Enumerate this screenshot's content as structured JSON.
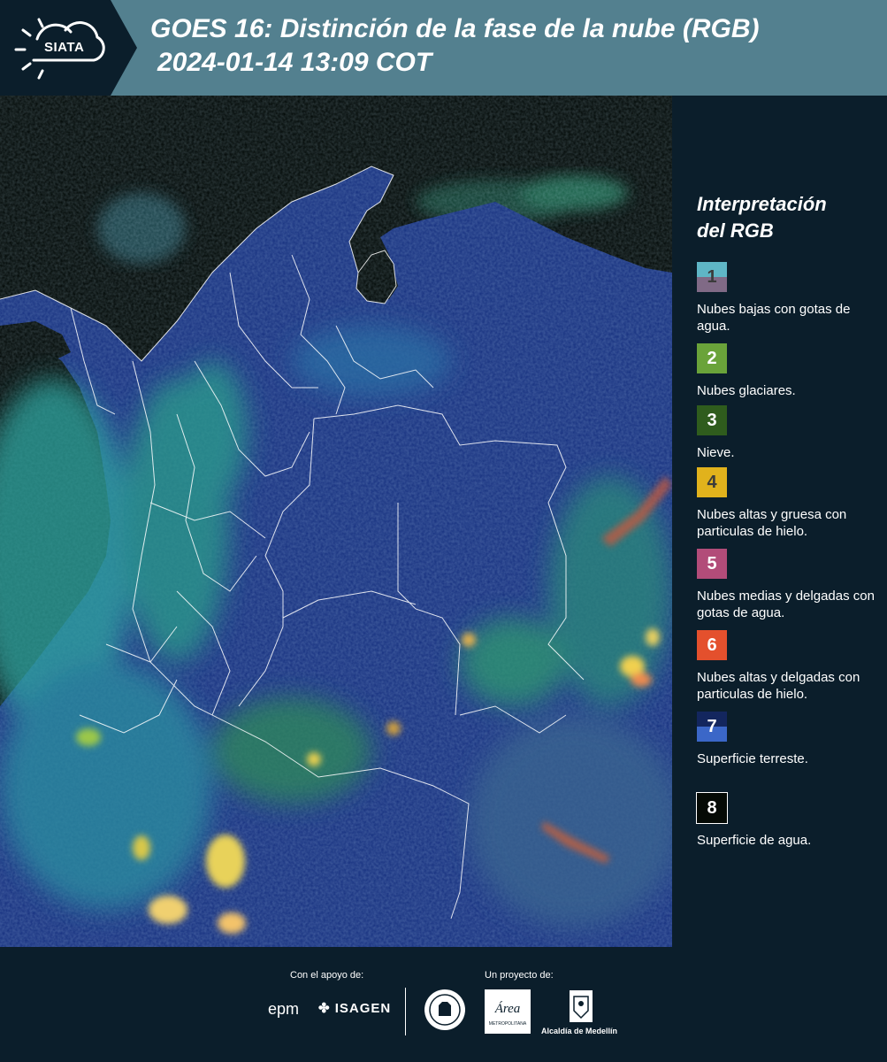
{
  "header": {
    "logo_text": "SIATA",
    "title": "GOES 16: Distinción de la fase de la nube (RGB)",
    "datetime": "2024-01-14 13:09 COT"
  },
  "legend": {
    "title_line1": "Interpretación",
    "title_line2": "del RGB",
    "items": [
      {
        "number": "1",
        "label": "Nubes bajas con gotas de agua.",
        "color_top": "#5fb6c6",
        "color_bottom": "#806a86",
        "num_color": "#3b3b3b"
      },
      {
        "number": "2",
        "label": "Nubes glaciares.",
        "color_top": "#6aa33a",
        "color_bottom": "#6aa33a",
        "num_color": "#ffffff"
      },
      {
        "number": "3",
        "label": "Nieve.",
        "color_top": "#2f5c1d",
        "color_bottom": "#2f5c1d",
        "num_color": "#ffffff"
      },
      {
        "number": "4",
        "label": "Nubes altas y gruesa con particulas de hielo.",
        "color_top": "#e1b21c",
        "color_bottom": "#e1b21c",
        "num_color": "#3b3b3b"
      },
      {
        "number": "5",
        "label": "Nubes medias y delgadas con gotas de agua.",
        "color_top": "#b24c79",
        "color_bottom": "#b24c79",
        "num_color": "#ffffff"
      },
      {
        "number": "6",
        "label": "Nubes altas y delgadas con particulas de hielo.",
        "color_top": "#e4502d",
        "color_bottom": "#e4502d",
        "num_color": "#ffffff"
      },
      {
        "number": "7",
        "label": "Superficie terreste.",
        "color_top": "#13265e",
        "color_bottom": "#3b67c8",
        "num_color": "#ffffff"
      },
      {
        "number": "8",
        "label": "Superficie de agua.",
        "color_top": "#050a05",
        "color_bottom": "#050a05",
        "num_color": "#ffffff"
      }
    ]
  },
  "footer": {
    "support_label": "Con el apoyo de:",
    "project_label": "Un proyecto de:",
    "epm": "epm",
    "isagen": "ISAGEN",
    "area_text": "Área",
    "area_sub": "METROPOLITANA",
    "alcaldia": "Alcaldía de Medellín"
  },
  "colors": {
    "background": "#0b1e2b",
    "header": "#53808f",
    "ocean": "#050a08",
    "land": "#1b3583",
    "cloud_cyan": "#3fbfb0",
    "cloud_yellow": "#f0e070"
  }
}
